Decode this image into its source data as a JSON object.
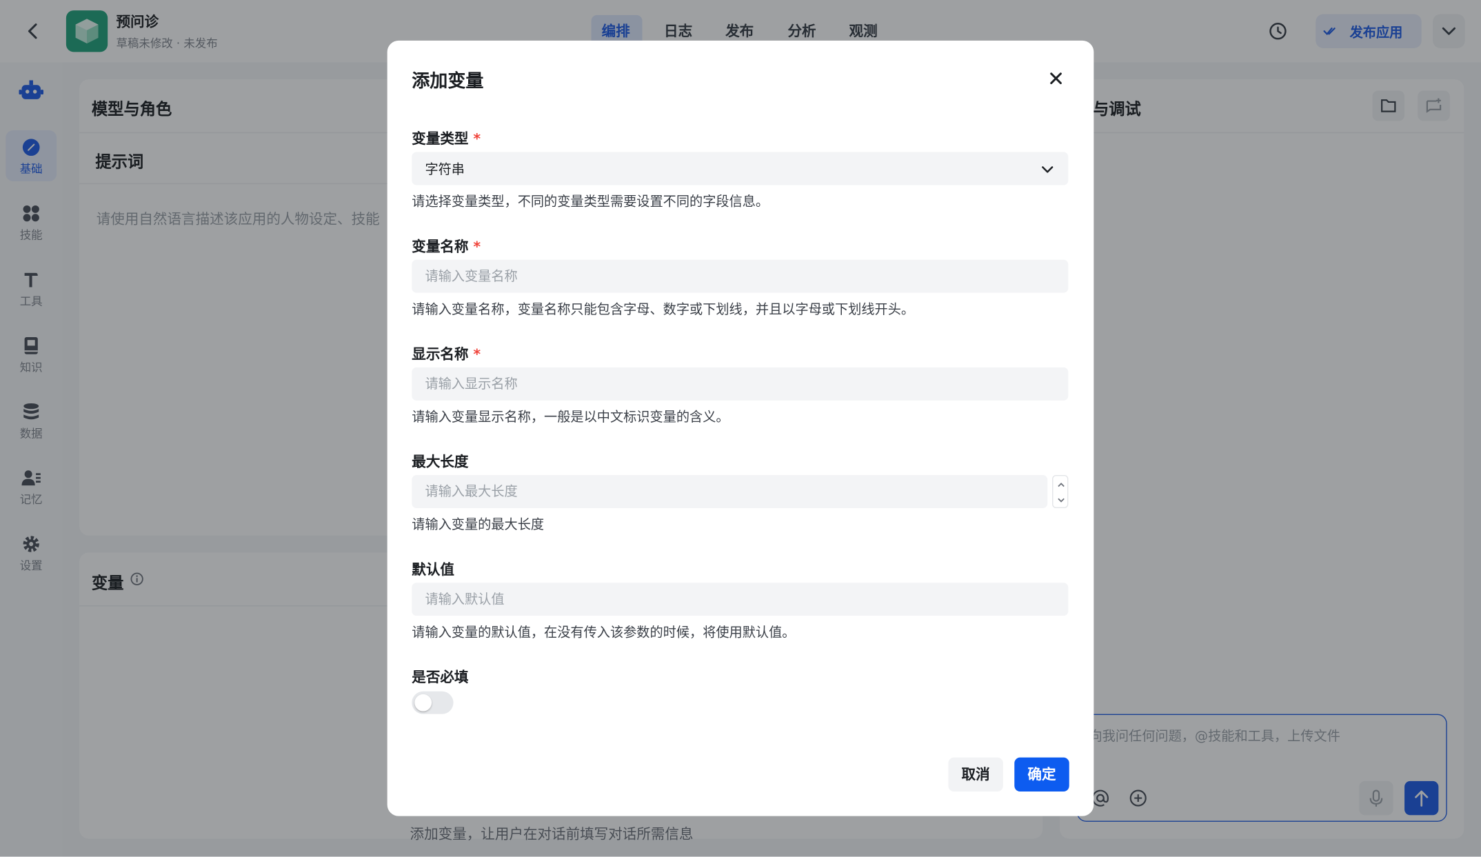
{
  "header": {
    "app_name": "预问诊",
    "app_status": "草稿未修改 · 未发布",
    "tabs": [
      {
        "label": "编排",
        "active": true
      },
      {
        "label": "日志",
        "active": false
      },
      {
        "label": "发布",
        "active": false
      },
      {
        "label": "分析",
        "active": false
      },
      {
        "label": "观测",
        "active": false
      }
    ],
    "publish_label": "发布应用"
  },
  "sidebar": {
    "items": [
      {
        "label": "基础",
        "icon": "compass-icon",
        "active": true
      },
      {
        "label": "技能",
        "icon": "skills-icon",
        "active": false
      },
      {
        "label": "工具",
        "icon": "hammer-icon",
        "active": false
      },
      {
        "label": "知识",
        "icon": "book-icon",
        "active": false
      },
      {
        "label": "数据",
        "icon": "database-icon",
        "active": false
      },
      {
        "label": "记忆",
        "icon": "user-memory-icon",
        "active": false
      },
      {
        "label": "设置",
        "icon": "gear-icon",
        "active": false
      }
    ]
  },
  "left_panel": {
    "title": "模型与角色",
    "prompt_title": "提示词",
    "prompt_placeholder": "请使用自然语言描述该应用的人物设定、技能"
  },
  "variables_panel": {
    "title": "变量",
    "hint": "添加变量，让用户在对话前填写对话所需信息"
  },
  "debug_panel": {
    "title": "览与调试",
    "chat_placeholder": "向我问任何问题，@技能和工具，上传文件"
  },
  "modal": {
    "title": "添加变量",
    "type_field": {
      "label": "变量类型",
      "value": "字符串",
      "help": "请选择变量类型，不同的变量类型需要设置不同的字段信息。"
    },
    "name_field": {
      "label": "变量名称",
      "placeholder": "请输入变量名称",
      "help": "请输入变量名称，变量名称只能包含字母、数字或下划线，并且以字母或下划线开头。"
    },
    "display_field": {
      "label": "显示名称",
      "placeholder": "请输入显示名称",
      "help": "请输入变量显示名称，一般是以中文标识变量的含义。"
    },
    "maxlen_field": {
      "label": "最大长度",
      "placeholder": "请输入最大长度",
      "help": "请输入变量的最大长度"
    },
    "default_field": {
      "label": "默认值",
      "placeholder": "请输入默认值",
      "help": "请输入变量的默认值，在没有传入该参数的时候，将使用默认值。"
    },
    "required_field": {
      "label": "是否必填",
      "enabled": false
    },
    "cancel_label": "取消",
    "ok_label": "确定",
    "required_mark": "*"
  },
  "colors": {
    "accent": "#0d5cf0",
    "app_icon": "#1fa37a",
    "required": "#f0433a"
  }
}
